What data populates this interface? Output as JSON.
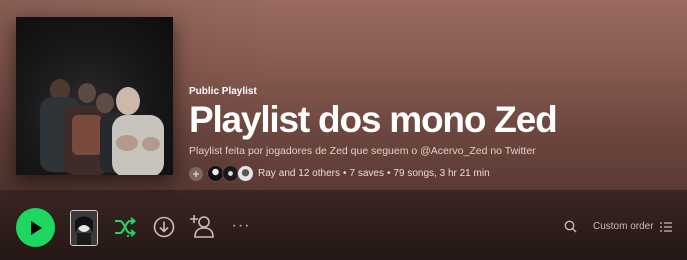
{
  "playlist": {
    "type_label": "Public Playlist",
    "title": "Playlist dos mono Zed",
    "description": "Playlist feita por jogadores de Zed que seguem o @Acervo_Zed no Twitter",
    "owner": "Ray",
    "collaborators": "and 12 others",
    "saves": "7 saves",
    "stats": "79 songs, 3 hr 21 min"
  },
  "icons": {
    "add_collaborator": "plus-icon",
    "play": "play-icon",
    "shuffle": "shuffle-icon",
    "download": "download-icon",
    "invite": "add-user-icon",
    "more": "more-icon",
    "search": "search-icon",
    "list": "list-icon"
  },
  "actions": {
    "more_label": "···",
    "sort_label": "Custom order"
  },
  "colors": {
    "accent": "#1ed760",
    "header_top": "#9a6a5f",
    "header_bottom": "#5a3a33"
  }
}
